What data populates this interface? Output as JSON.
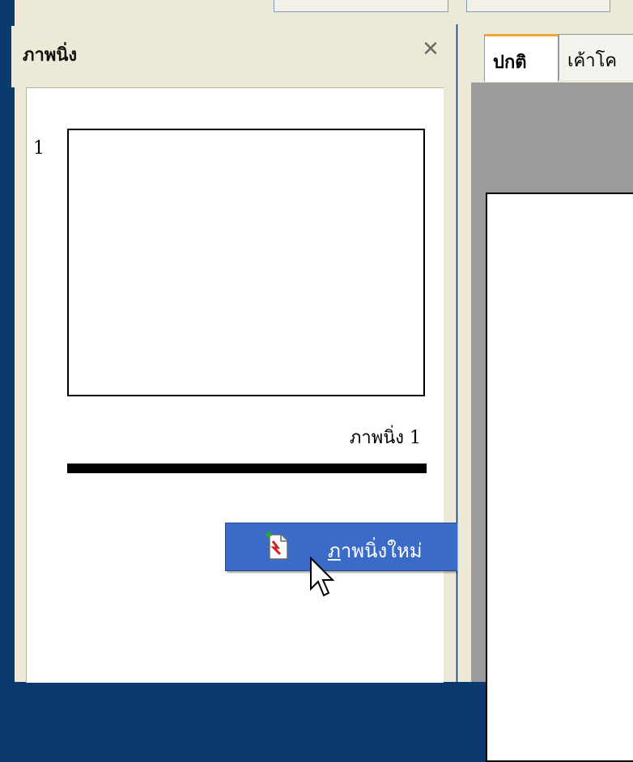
{
  "panel": {
    "title": "ภาพนิ่ง",
    "close_glyph": "✕"
  },
  "slides": [
    {
      "number": "1",
      "name": "ภาพนิ่ง 1"
    }
  ],
  "context_menu": {
    "item": {
      "accel": "ภ",
      "rest": "าพนิ่งใหม่",
      "icon": "new-slide-icon"
    }
  },
  "view_tabs": [
    {
      "label": "ปกติ",
      "active": true
    },
    {
      "label": "เค้าโค",
      "active": false
    }
  ],
  "colors": {
    "desktop": "#0b3a6e",
    "menu_highlight": "#3b6bc8",
    "active_tab_accent": "#f1a23c",
    "editor_bg": "#9b9b9b"
  }
}
